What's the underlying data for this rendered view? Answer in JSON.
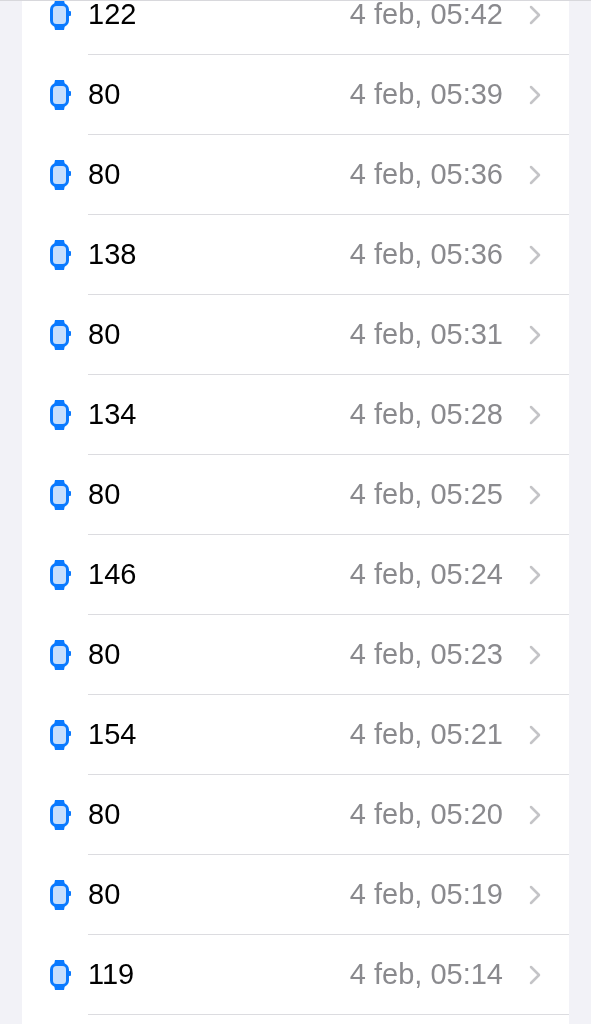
{
  "readings": [
    {
      "value": "122",
      "time": "4 feb, 05:42"
    },
    {
      "value": "80",
      "time": "4 feb, 05:39"
    },
    {
      "value": "80",
      "time": "4 feb, 05:36"
    },
    {
      "value": "138",
      "time": "4 feb, 05:36"
    },
    {
      "value": "80",
      "time": "4 feb, 05:31"
    },
    {
      "value": "134",
      "time": "4 feb, 05:28"
    },
    {
      "value": "80",
      "time": "4 feb, 05:25"
    },
    {
      "value": "146",
      "time": "4 feb, 05:24"
    },
    {
      "value": "80",
      "time": "4 feb, 05:23"
    },
    {
      "value": "154",
      "time": "4 feb, 05:21"
    },
    {
      "value": "80",
      "time": "4 feb, 05:20"
    },
    {
      "value": "80",
      "time": "4 feb, 05:19"
    },
    {
      "value": "119",
      "time": "4 feb, 05:14"
    }
  ]
}
